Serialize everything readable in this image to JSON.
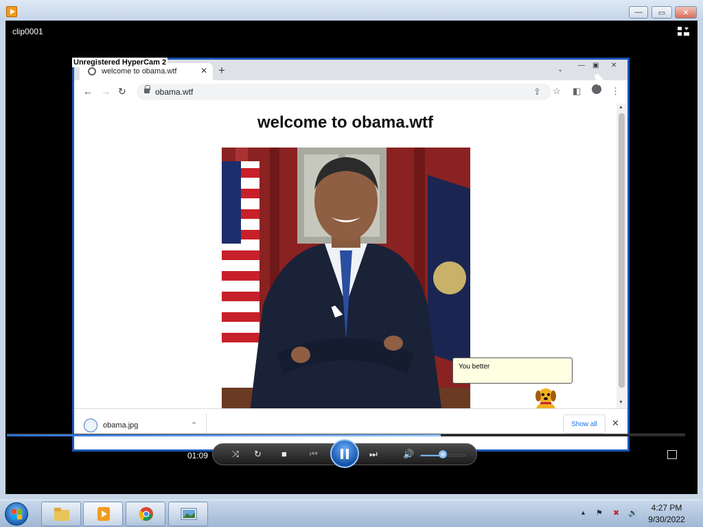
{
  "window": {
    "title": "clip0001",
    "minimize": "—",
    "maximize": "▭",
    "close": "✕"
  },
  "recording": {
    "watermark": "Unregistered HyperCam 2",
    "tab_title": "welcome to obama.wtf",
    "tab_close": "✕",
    "new_tab": "+",
    "url": "obama.wtf",
    "page_heading": "welcome to obama.wtf",
    "speech_bubble": "You better",
    "download_filename": "obama.jpg",
    "show_all": "Show all",
    "download_close": "✕"
  },
  "player": {
    "elapsed": "01:09",
    "progress_fraction": 0.64,
    "volume_fraction": 0.5
  },
  "taskbar": {
    "clock_time": "4:27 PM",
    "clock_date": "9/30/2022",
    "pinned": [
      "file-explorer",
      "windows-media-player",
      "chrome",
      "photo-viewer"
    ]
  }
}
